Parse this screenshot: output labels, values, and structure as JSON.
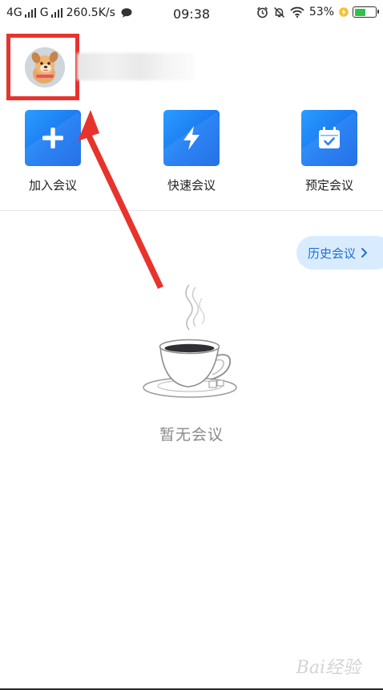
{
  "status_bar": {
    "network1": "4G",
    "network2": "G",
    "speed": "260.5K/s",
    "time": "09:38",
    "battery_percent": "53%",
    "battery_level": 0.53
  },
  "profile": {
    "avatar_icon": "cartoon-dog-avatar",
    "highlight_color": "#e8332d"
  },
  "actions": {
    "join_label": "加入会议",
    "quick_label": "快速会议",
    "schedule_label": "预定会议"
  },
  "history": {
    "label": "历史会议"
  },
  "empty_state": {
    "icon": "coffee-cup-icon",
    "text": "暂无会议"
  },
  "watermark": "Bai经验",
  "colors": {
    "accent": "#1a78f2",
    "annotation_red": "#e8332d",
    "history_bg": "#d9ecff",
    "history_text": "#1f6fd1"
  }
}
